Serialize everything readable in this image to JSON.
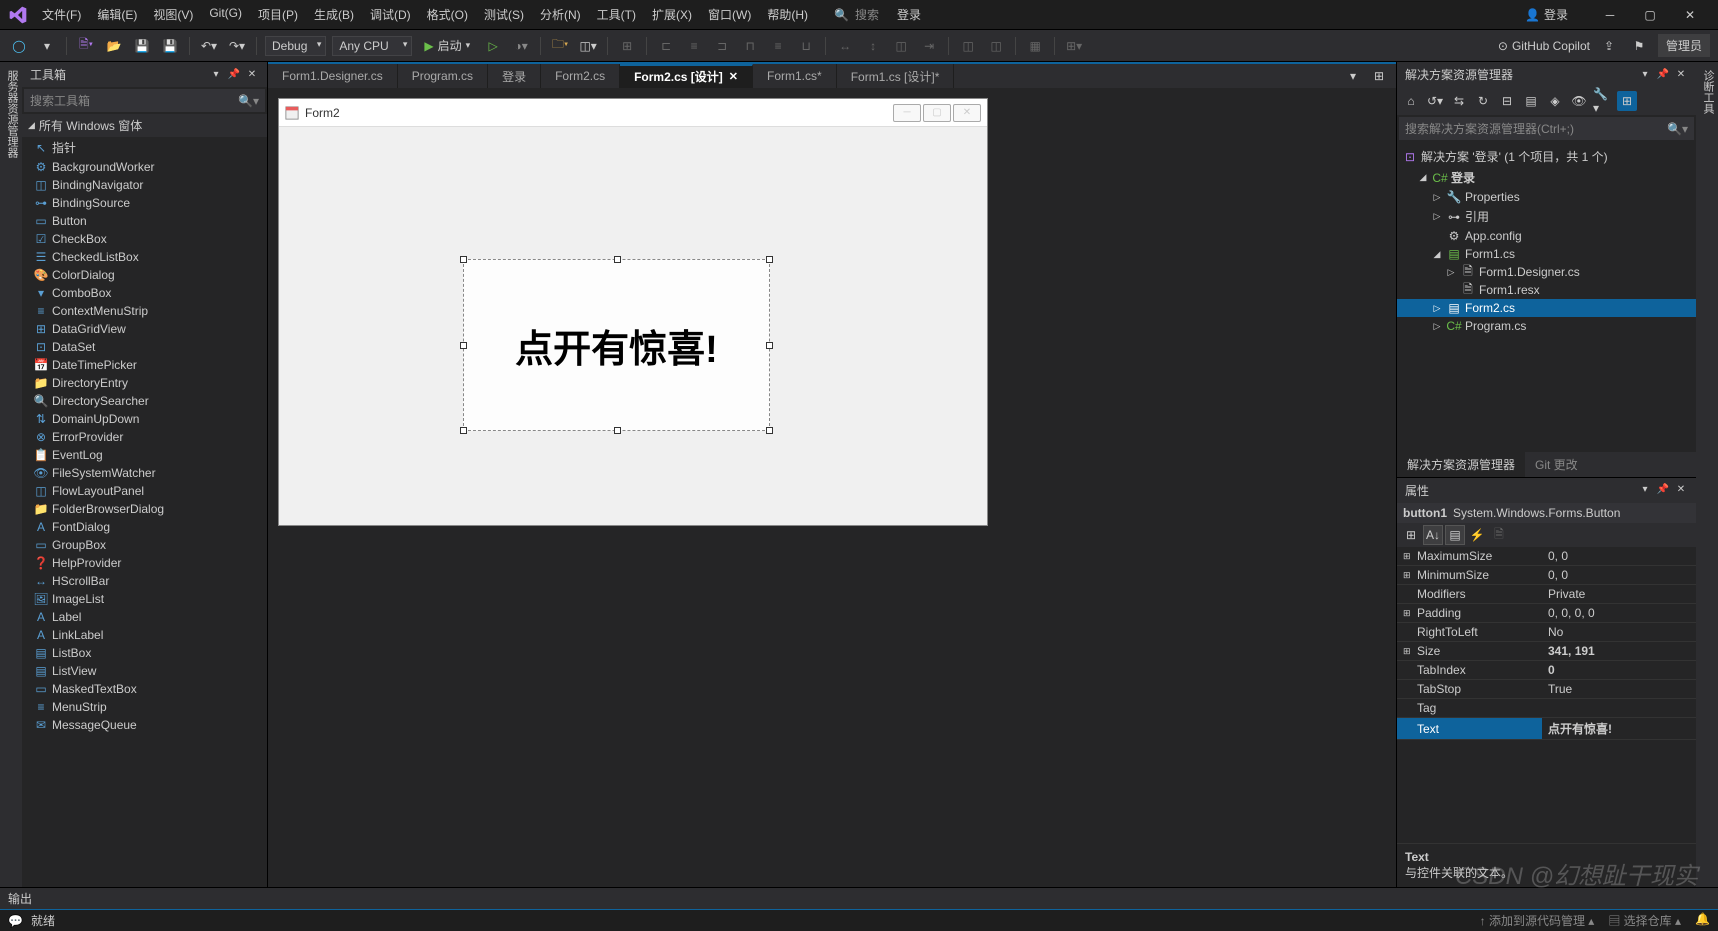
{
  "title": {
    "login": "登录",
    "copilot": "GitHub Copilot",
    "admin": "管理员"
  },
  "menu": [
    "文件(F)",
    "编辑(E)",
    "视图(V)",
    "Git(G)",
    "项目(P)",
    "生成(B)",
    "调试(D)",
    "格式(O)",
    "测试(S)",
    "分析(N)",
    "工具(T)",
    "扩展(X)",
    "窗口(W)",
    "帮助(H)"
  ],
  "search_placeholder": "搜索",
  "toolbar": {
    "config": "Debug",
    "platform": "Any CPU",
    "start": "启动"
  },
  "left_tab": "服务器资源管理器",
  "toolbox": {
    "title": "工具箱",
    "search": "搜索工具箱",
    "section": "所有 Windows 窗体",
    "items": [
      "指针",
      "BackgroundWorker",
      "BindingNavigator",
      "BindingSource",
      "Button",
      "CheckBox",
      "CheckedListBox",
      "ColorDialog",
      "ComboBox",
      "ContextMenuStrip",
      "DataGridView",
      "DataSet",
      "DateTimePicker",
      "DirectoryEntry",
      "DirectorySearcher",
      "DomainUpDown",
      "ErrorProvider",
      "EventLog",
      "FileSystemWatcher",
      "FlowLayoutPanel",
      "FolderBrowserDialog",
      "FontDialog",
      "GroupBox",
      "HelpProvider",
      "HScrollBar",
      "ImageList",
      "Label",
      "LinkLabel",
      "ListBox",
      "ListView",
      "MaskedTextBox",
      "MenuStrip",
      "MessageQueue"
    ]
  },
  "tabs": [
    {
      "label": "Form1.Designer.cs",
      "active": false
    },
    {
      "label": "Program.cs",
      "active": false
    },
    {
      "label": "登录",
      "active": false
    },
    {
      "label": "Form2.cs",
      "active": false
    },
    {
      "label": "Form2.cs [设计]",
      "active": true
    },
    {
      "label": "Form1.cs*",
      "active": false
    },
    {
      "label": "Form1.cs [设计]*",
      "active": false
    }
  ],
  "designer": {
    "form_title": "Form2",
    "button_text": "点开有惊喜!"
  },
  "solution": {
    "title": "解决方案资源管理器",
    "search": "搜索解决方案资源管理器(Ctrl+;)",
    "root": "解决方案 '登录' (1 个项目，共 1 个)",
    "project": "登录",
    "nodes": {
      "properties": "Properties",
      "refs": "引用",
      "appconfig": "App.config",
      "form1": "Form1.cs",
      "form1d": "Form1.Designer.cs",
      "form1r": "Form1.resx",
      "form2": "Form2.cs",
      "program": "Program.cs"
    },
    "tabs": {
      "sol": "解决方案资源管理器",
      "git": "Git 更改"
    }
  },
  "properties": {
    "title": "属性",
    "obj_name": "button1",
    "obj_type": "System.Windows.Forms.Button",
    "rows": [
      {
        "name": "MaximumSize",
        "val": "0, 0",
        "exp": "⊞"
      },
      {
        "name": "MinimumSize",
        "val": "0, 0",
        "exp": "⊞"
      },
      {
        "name": "Modifiers",
        "val": "Private"
      },
      {
        "name": "Padding",
        "val": "0, 0, 0, 0",
        "exp": "⊞"
      },
      {
        "name": "RightToLeft",
        "val": "No"
      },
      {
        "name": "Size",
        "val": "341, 191",
        "exp": "⊞",
        "bold": true
      },
      {
        "name": "TabIndex",
        "val": "0",
        "bold": true
      },
      {
        "name": "TabStop",
        "val": "True"
      },
      {
        "name": "Tag",
        "val": ""
      },
      {
        "name": "Text",
        "val": "点开有惊喜!",
        "bold": true,
        "selected": true
      }
    ],
    "desc_title": "Text",
    "desc_body": "与控件关联的文本。"
  },
  "right_tab": "诊断工具",
  "output": "输出",
  "status": {
    "ready": "就绪",
    "add_src": "添加到源代码管理",
    "select_repo": "选择仓库"
  },
  "watermark": "CSDN @幻想趾干现实"
}
